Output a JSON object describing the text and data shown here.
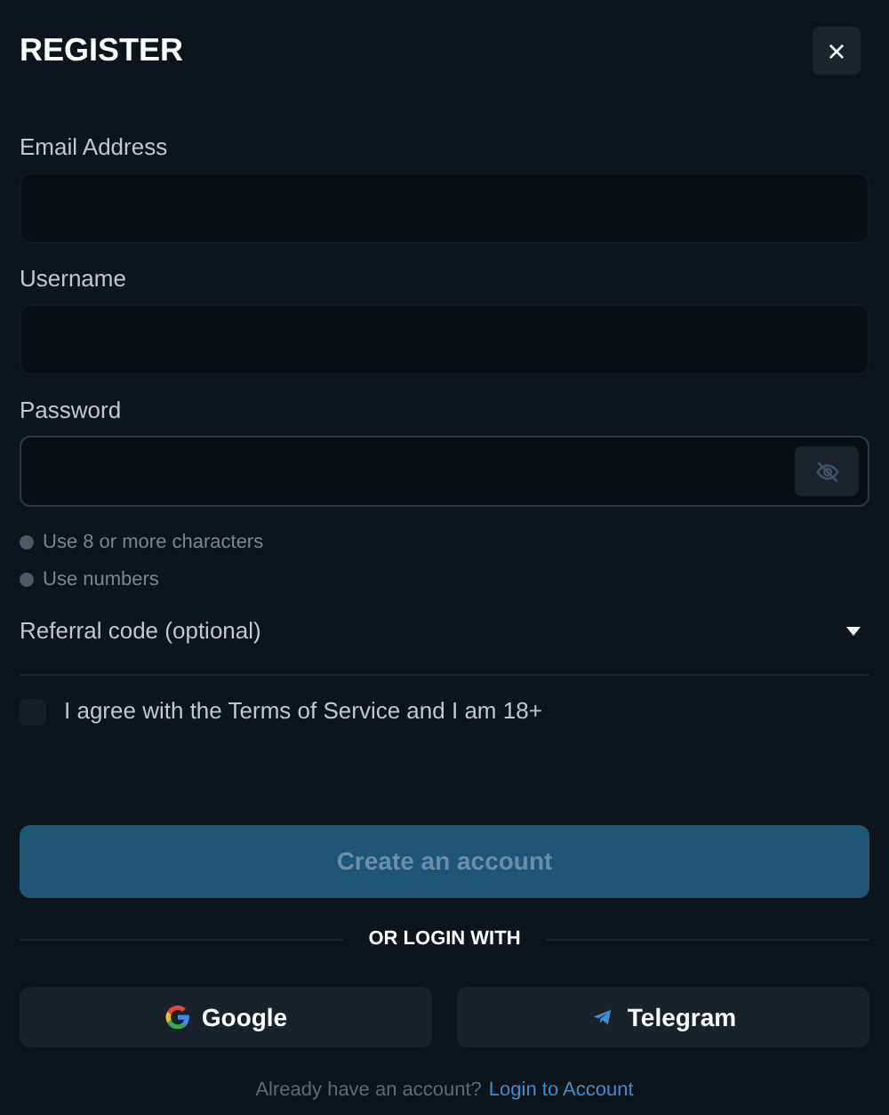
{
  "title": "REGISTER",
  "close": {
    "label": "×"
  },
  "fields": [
    {
      "label": "Email Address",
      "kind": "text",
      "focused": false
    },
    {
      "label": "Username",
      "kind": "text",
      "focused": false
    },
    {
      "label": "Password",
      "kind": "password",
      "focused": true
    }
  ],
  "rules": [
    {
      "text": "Use 8 or more characters",
      "met": false
    },
    {
      "text": "Use numbers",
      "met": false
    }
  ],
  "referral": {
    "label": "Referral code (optional)",
    "expanded": false
  },
  "agree": {
    "label": "I agree with the Terms of Service and I am 18+",
    "checked": false
  },
  "submit": {
    "label": "Create an account",
    "disabled": true
  },
  "divider": "OR LOGIN WITH",
  "social": [
    {
      "label": "Google",
      "kind": "google"
    },
    {
      "label": "Telegram",
      "kind": "telegram"
    }
  ],
  "footer": {
    "text": "Already have an account?",
    "link": "Login to Account"
  }
}
